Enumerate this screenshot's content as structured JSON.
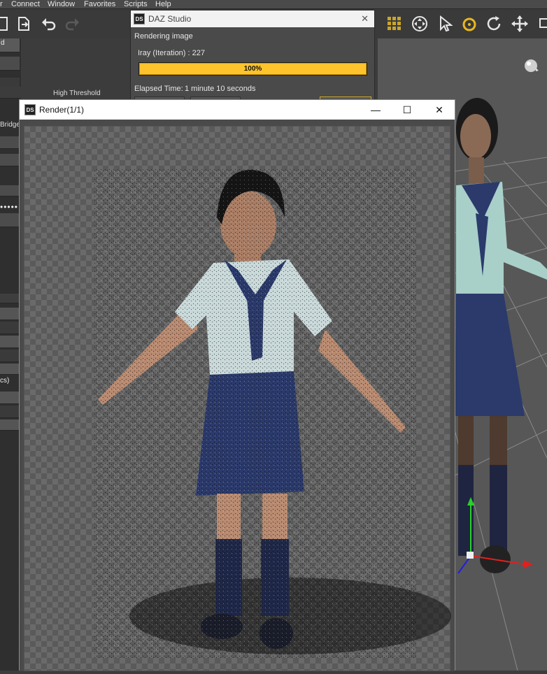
{
  "menubar": {
    "items": [
      "r",
      "Connect",
      "Window",
      "Favorites",
      "Scripts",
      "Help"
    ]
  },
  "left_panel": {
    "tab_label": "d",
    "high_threshold_label": "High Threshold",
    "bridge_label": "Bridge",
    "truncated_label": "cs)"
  },
  "progress_dialog": {
    "title": "DAZ Studio",
    "status": "Rendering image",
    "iteration_text": "Iray (Iteration) : 227",
    "progress_text": "100%",
    "progress_fraction": 1.0,
    "elapsed_label": "Elapsed Time:",
    "elapsed_value": "1 minute 10 seconds",
    "close_glyph": "✕",
    "logo": "DS"
  },
  "render_window": {
    "title": "Render(1/1)",
    "logo": "DS",
    "minimize_glyph": "—",
    "maximize_glyph": "☐",
    "close_glyph": "✕"
  },
  "toolbar": {
    "icons": [
      "new-scene-icon",
      "export-icon",
      "undo-icon",
      "redo-icon",
      "grid-icon",
      "universal-tool-icon",
      "pointer-icon",
      "orbit-icon",
      "rotate-icon",
      "translate-icon"
    ]
  },
  "colors": {
    "progress_fill": "#ffc32b",
    "viewport_bg": "#575757",
    "uniform_navy": "#2b3a6b"
  }
}
